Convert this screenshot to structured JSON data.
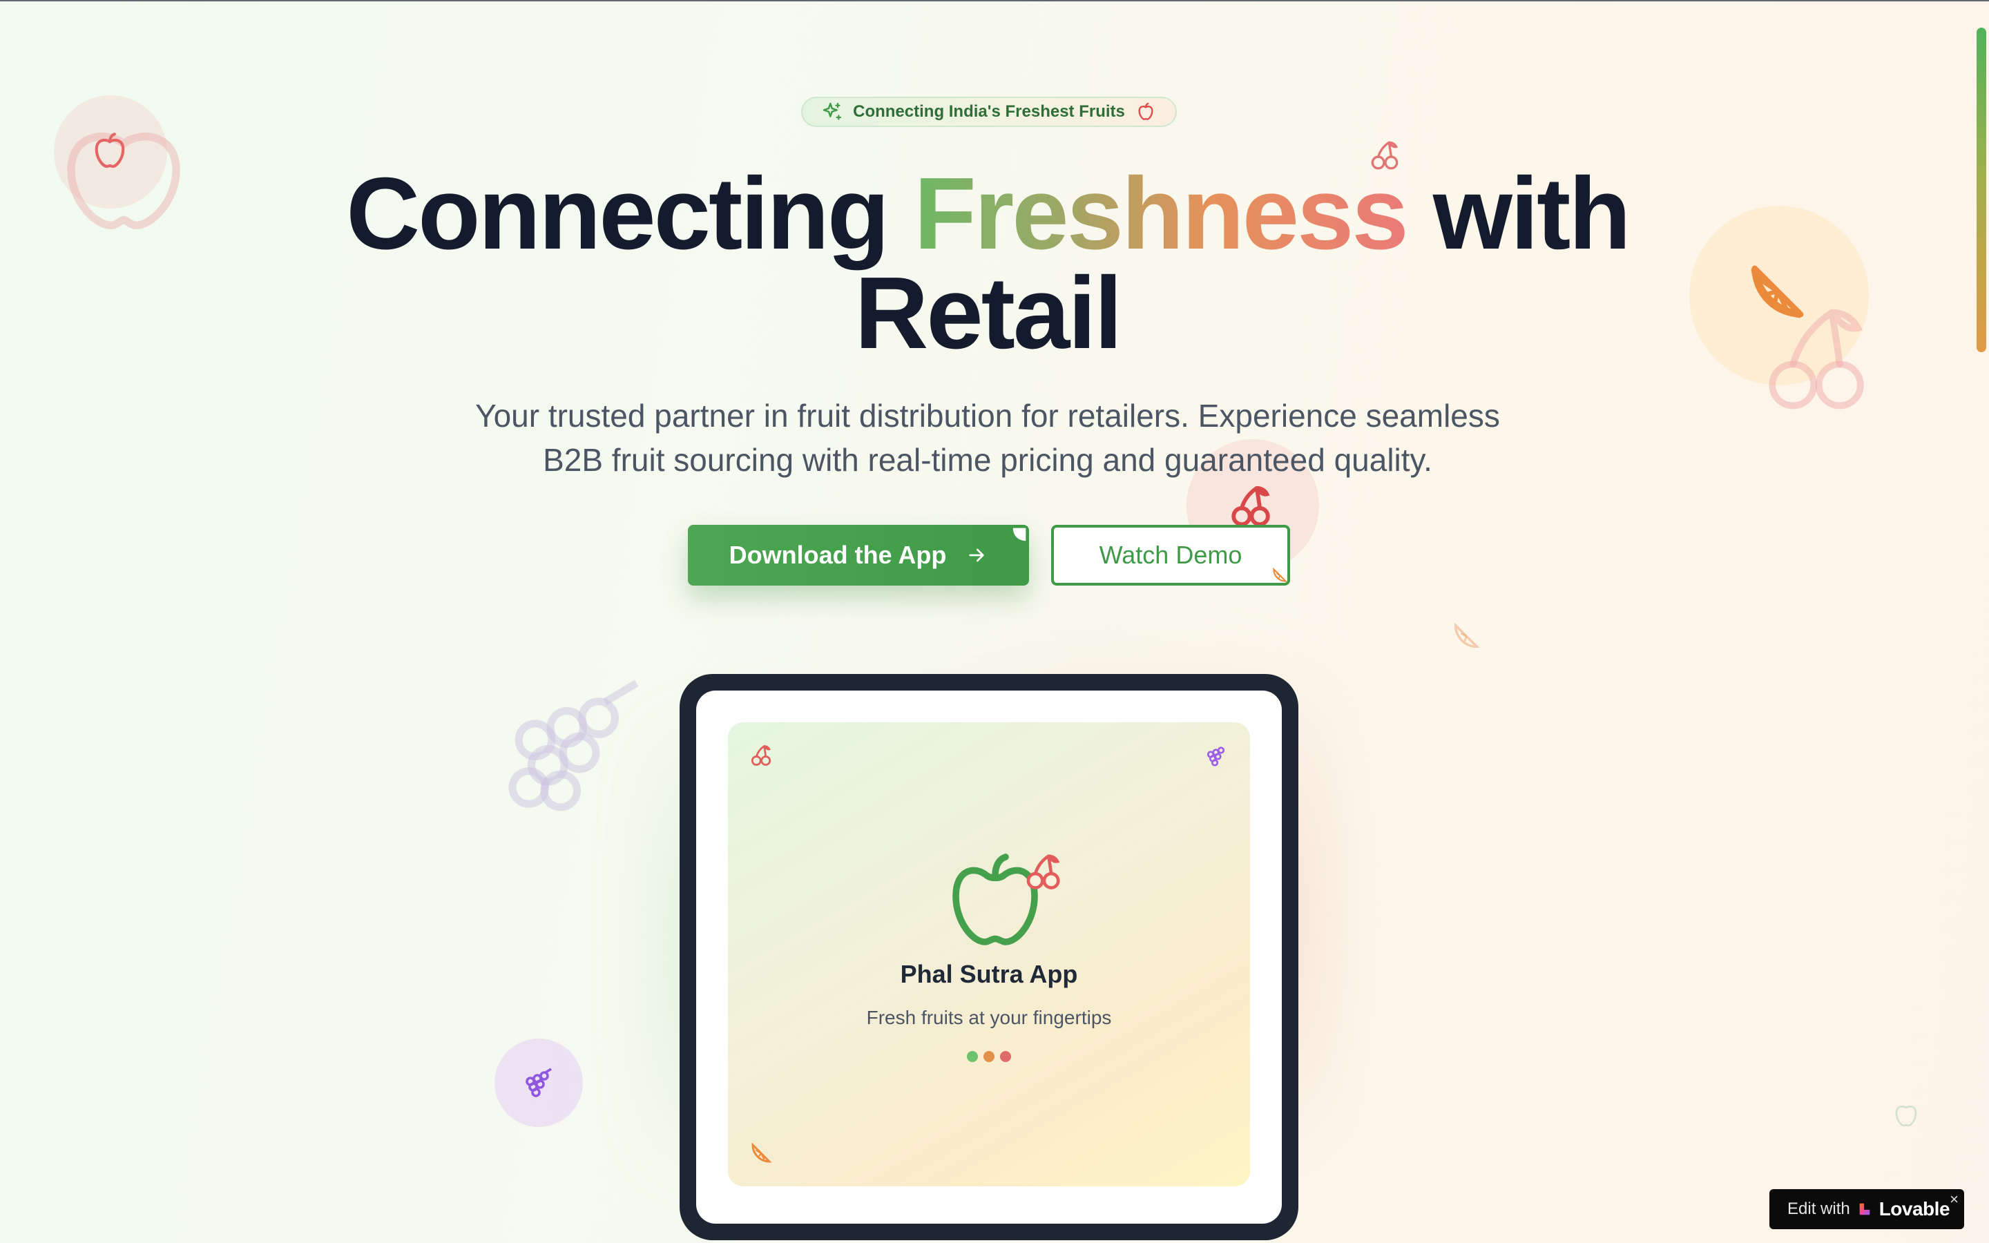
{
  "badge": {
    "text": "Connecting India's Freshest Fruits",
    "left_icon": "sparkles-icon",
    "right_icon": "apple-icon"
  },
  "hero": {
    "title_part1": "Connecting ",
    "title_highlight": "Freshness",
    "title_part2": " with",
    "title_line2": "Retail",
    "subtitle_line1": "Your trusted partner in fruit distribution for retailers. Experience seamless",
    "subtitle_line2": "B2B fruit sourcing with real-time pricing and guaranteed quality."
  },
  "actions": {
    "primary_label": "Download the App",
    "primary_icon": "arrow-right-icon",
    "secondary_label": "Watch Demo"
  },
  "app_preview": {
    "title": "Phal Sutra App",
    "subtitle": "Fresh fruits at your fingertips",
    "dot_colors": [
      "#6cc36b",
      "#e2914a",
      "#e06b6b"
    ]
  },
  "colors": {
    "primary_green": "#3f9a47",
    "heading": "#141b2d",
    "body_text": "#4b5563",
    "cherry_red": "#e25c5c",
    "orange": "#ec8a3c",
    "grape_purple": "#9b5de5"
  },
  "lovable_badge": {
    "edit_text": "Edit with",
    "brand_text": "Lovable",
    "close_label": "×"
  }
}
